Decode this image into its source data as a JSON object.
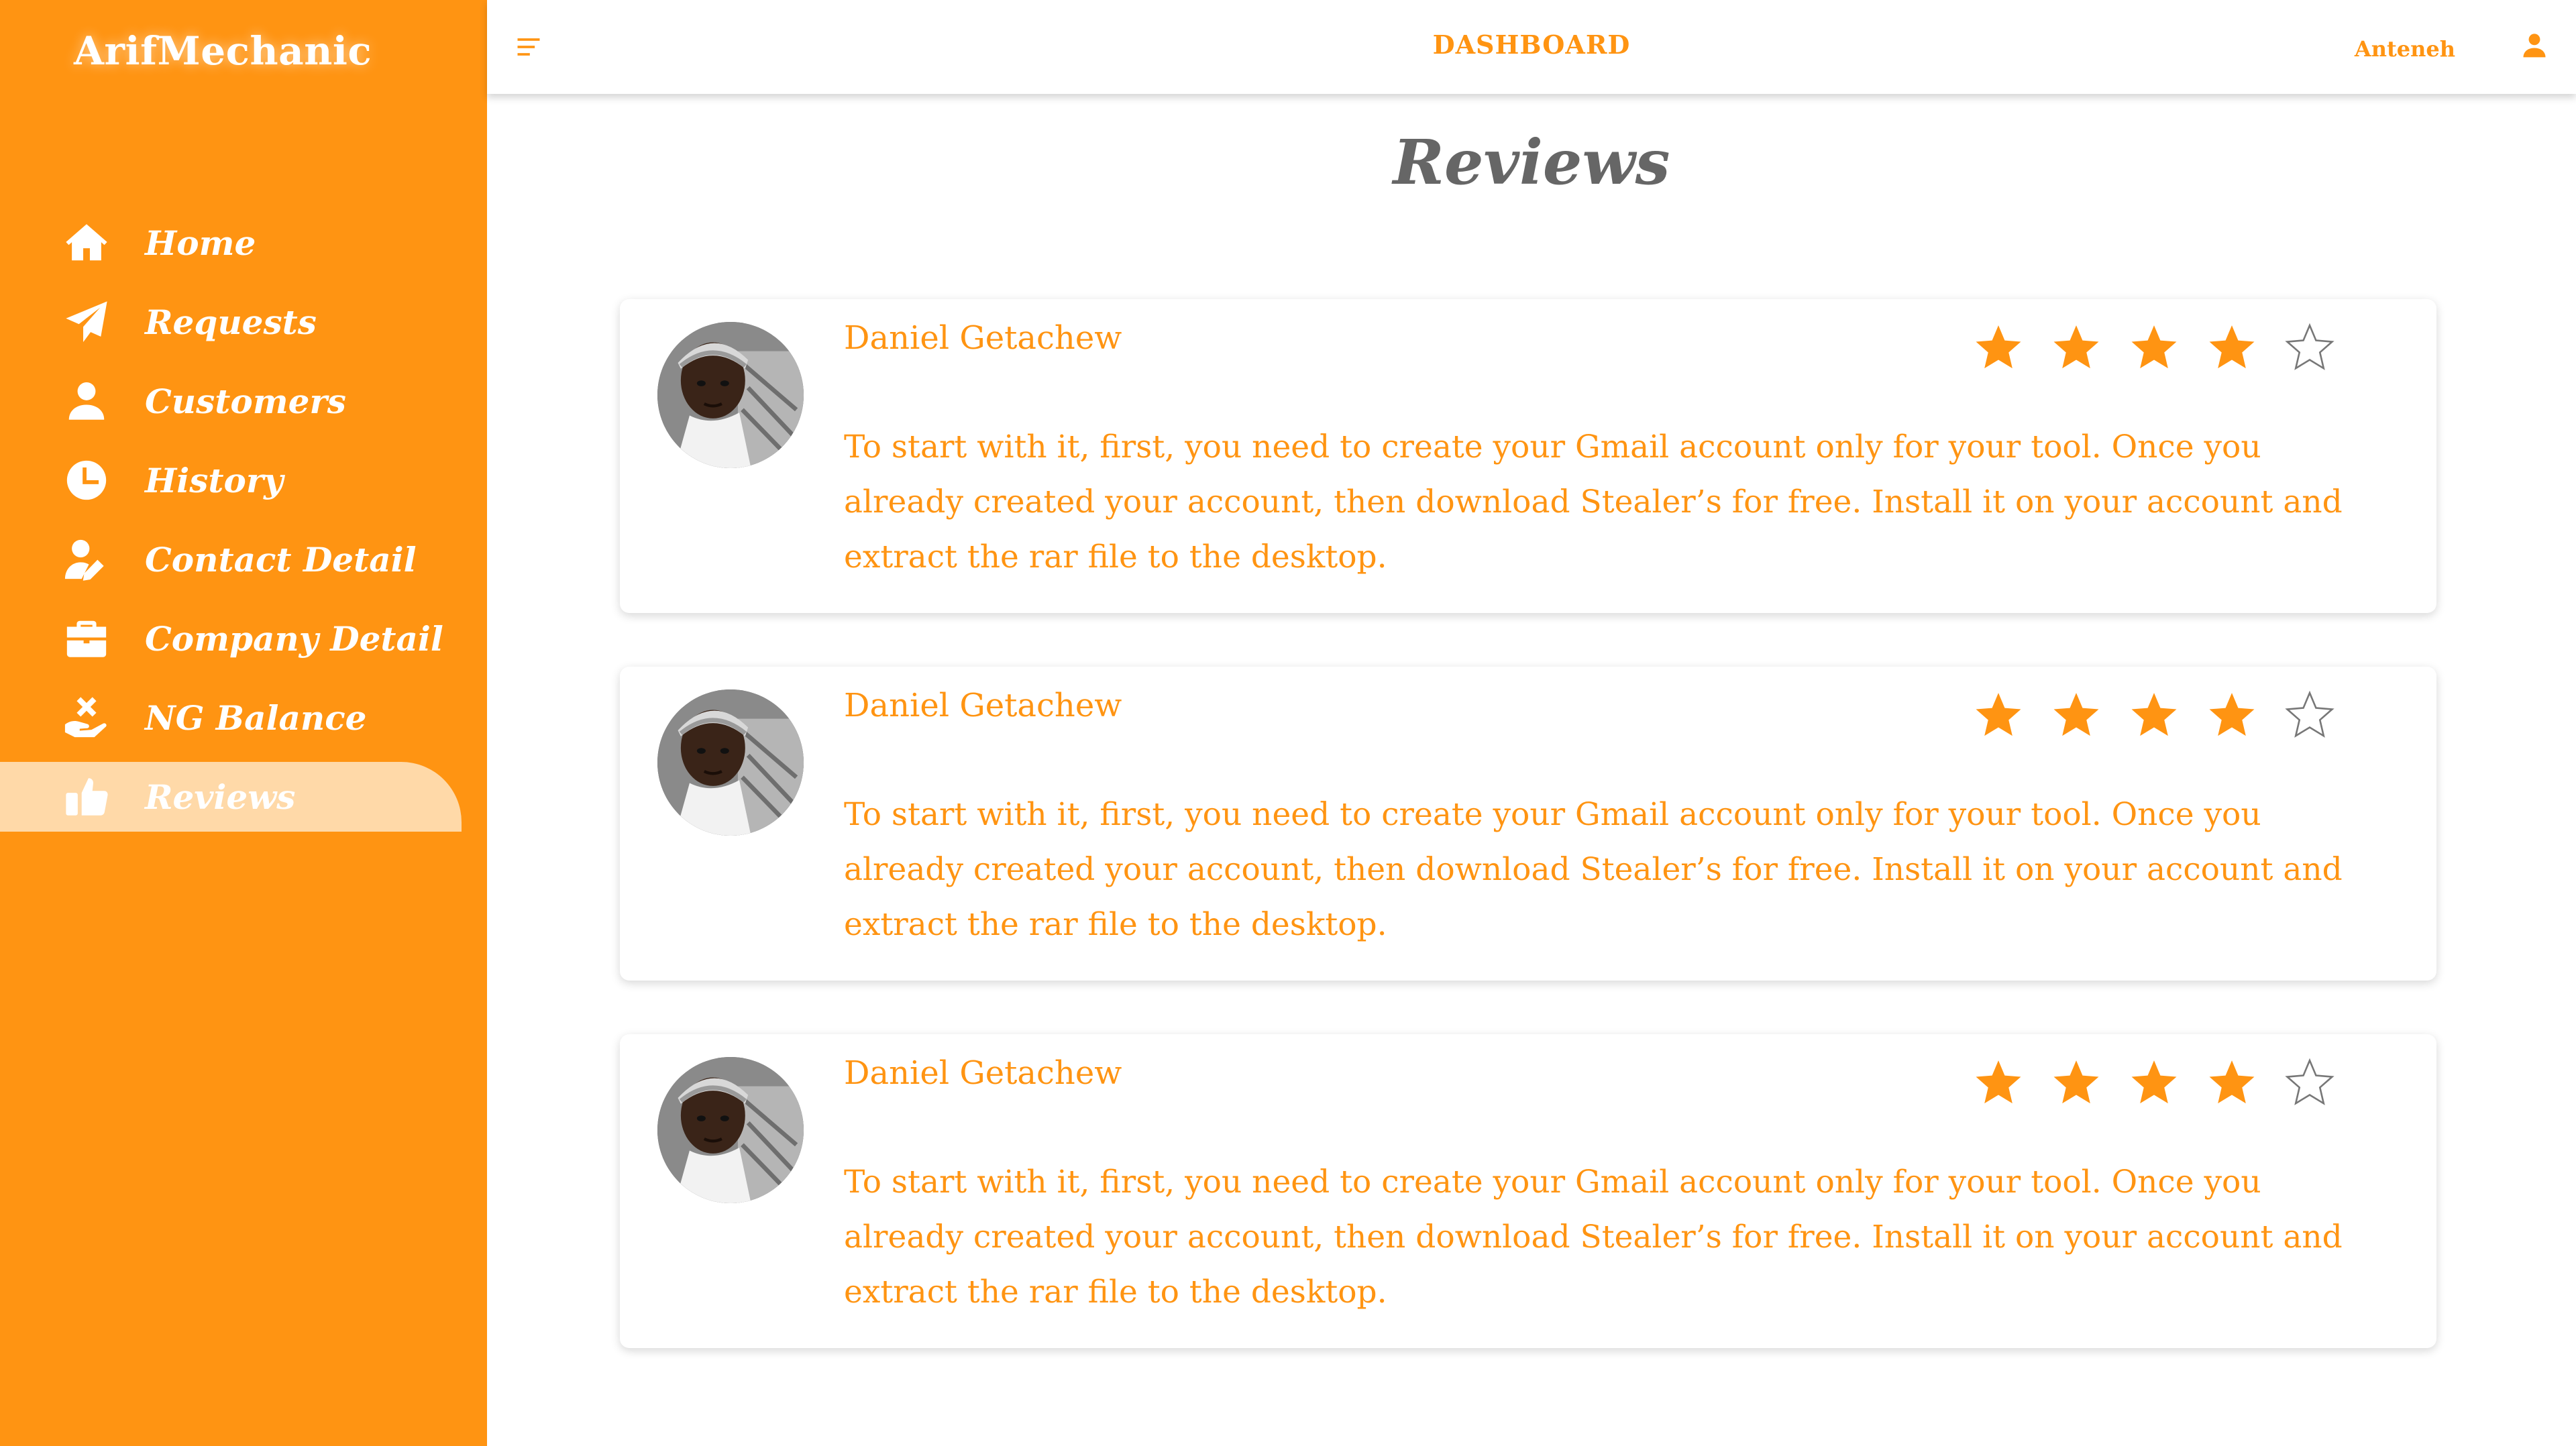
{
  "app": {
    "brand": "ArifMechanic"
  },
  "colors": {
    "accent": "#ff9412",
    "active_bg": "#ffd9a8",
    "title_gray": "#666666"
  },
  "sidebar": {
    "items": [
      {
        "label": "Home",
        "icon": "home-icon",
        "active": false
      },
      {
        "label": "Requests",
        "icon": "paper-plane-icon",
        "active": false
      },
      {
        "label": "Customers",
        "icon": "user-icon",
        "active": false
      },
      {
        "label": "History",
        "icon": "clock-icon",
        "active": false
      },
      {
        "label": "Contact Detail",
        "icon": "user-edit-icon",
        "active": false
      },
      {
        "label": "Company Detail",
        "icon": "briefcase-icon",
        "active": false
      },
      {
        "label": "NG Balance",
        "icon": "hand-holding-money-icon",
        "active": false
      },
      {
        "label": "Reviews",
        "icon": "thumbs-up-icon",
        "active": true
      }
    ]
  },
  "header": {
    "menu_icon": "menu-icon",
    "title": "DASHBOARD",
    "user_name": "Anteneh",
    "user_icon": "user-icon"
  },
  "main": {
    "title": "Reviews",
    "reviews": [
      {
        "name": "Daniel Getachew",
        "rating": 4,
        "max_rating": 5,
        "text": "To start with it, first, you need to create your Gmail account only for your tool. Once you already created your account, then download Stealer’s for free. Install it on your account and extract the rar file to the desktop."
      },
      {
        "name": "Daniel Getachew",
        "rating": 4,
        "max_rating": 5,
        "text": "To start with it, first, you need to create your Gmail account only for your tool. Once you already created your account, then download Stealer’s for free. Install it on your account and extract the rar file to the desktop."
      },
      {
        "name": "Daniel Getachew",
        "rating": 4,
        "max_rating": 5,
        "text": "To start with it, first, you need to create your Gmail account only for your tool. Once you already created your account, then download Stealer’s for free. Install it on your account and extract the rar file to the desktop."
      }
    ]
  }
}
